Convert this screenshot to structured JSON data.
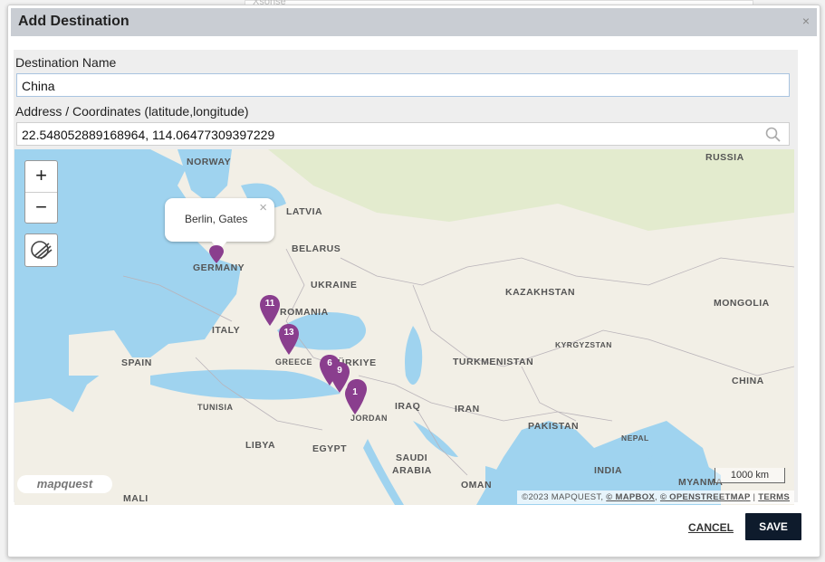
{
  "background_hint": "Xsonse",
  "dialog": {
    "title": "Add Destination",
    "close_glyph": "×"
  },
  "form": {
    "name_label": "Destination Name",
    "name_value": "China",
    "address_label": "Address / Coordinates (latitude,longitude)",
    "address_value": "22.548052889168964, 114.06477309397229"
  },
  "map": {
    "zoom_in": "+",
    "zoom_out": "−",
    "popup": {
      "text": "Berlin, Gates",
      "close": "×"
    },
    "labels": {
      "norway": "NORWAY",
      "russia": "RUSSIA",
      "latvia": "LATVIA",
      "belarus": "BELARUS",
      "germany": "GERMANY",
      "ukraine": "UKRAINE",
      "kazakhstan": "KAZAKHSTAN",
      "mongolia": "MONGOLIA",
      "romania": "ROMANIA",
      "italy": "ITALY",
      "kyrgyzstan": "KYRGYZSTAN",
      "greece": "GREECE",
      "spain": "SPAIN",
      "turkiye": "TÜRKIYE",
      "turkmenistan": "TURKMENISTAN",
      "china": "CHINA",
      "tunisia": "TUNISIA",
      "iraq": "IRAQ",
      "iran": "IRAN",
      "jordan": "JORDAN",
      "pakistan": "PAKISTAN",
      "libya": "LIBYA",
      "egypt": "EGYPT",
      "nepal": "NEPAL",
      "saudi": "SAUDI",
      "arabia": "ARABIA",
      "india": "INDIA",
      "myanmar": "MYANMA",
      "oman": "OMAN",
      "mali": "MALI"
    },
    "markers": [
      "11",
      "13",
      "6",
      "9",
      "1"
    ],
    "logo": "mapquest",
    "scale": "1000 km",
    "attribution": {
      "copyright": "©2023 MAPQUEST, ",
      "mapbox": "© MAPBOX",
      "osm": "© OPENSTREETMAP",
      "sep": " | ",
      "terms": "TERMS"
    },
    "colors": {
      "water": "#9fd3ef",
      "land": "#f2efe6",
      "marker": "#8a3e8e"
    }
  },
  "buttons": {
    "cancel": "CANCEL",
    "save": "SAVE"
  }
}
